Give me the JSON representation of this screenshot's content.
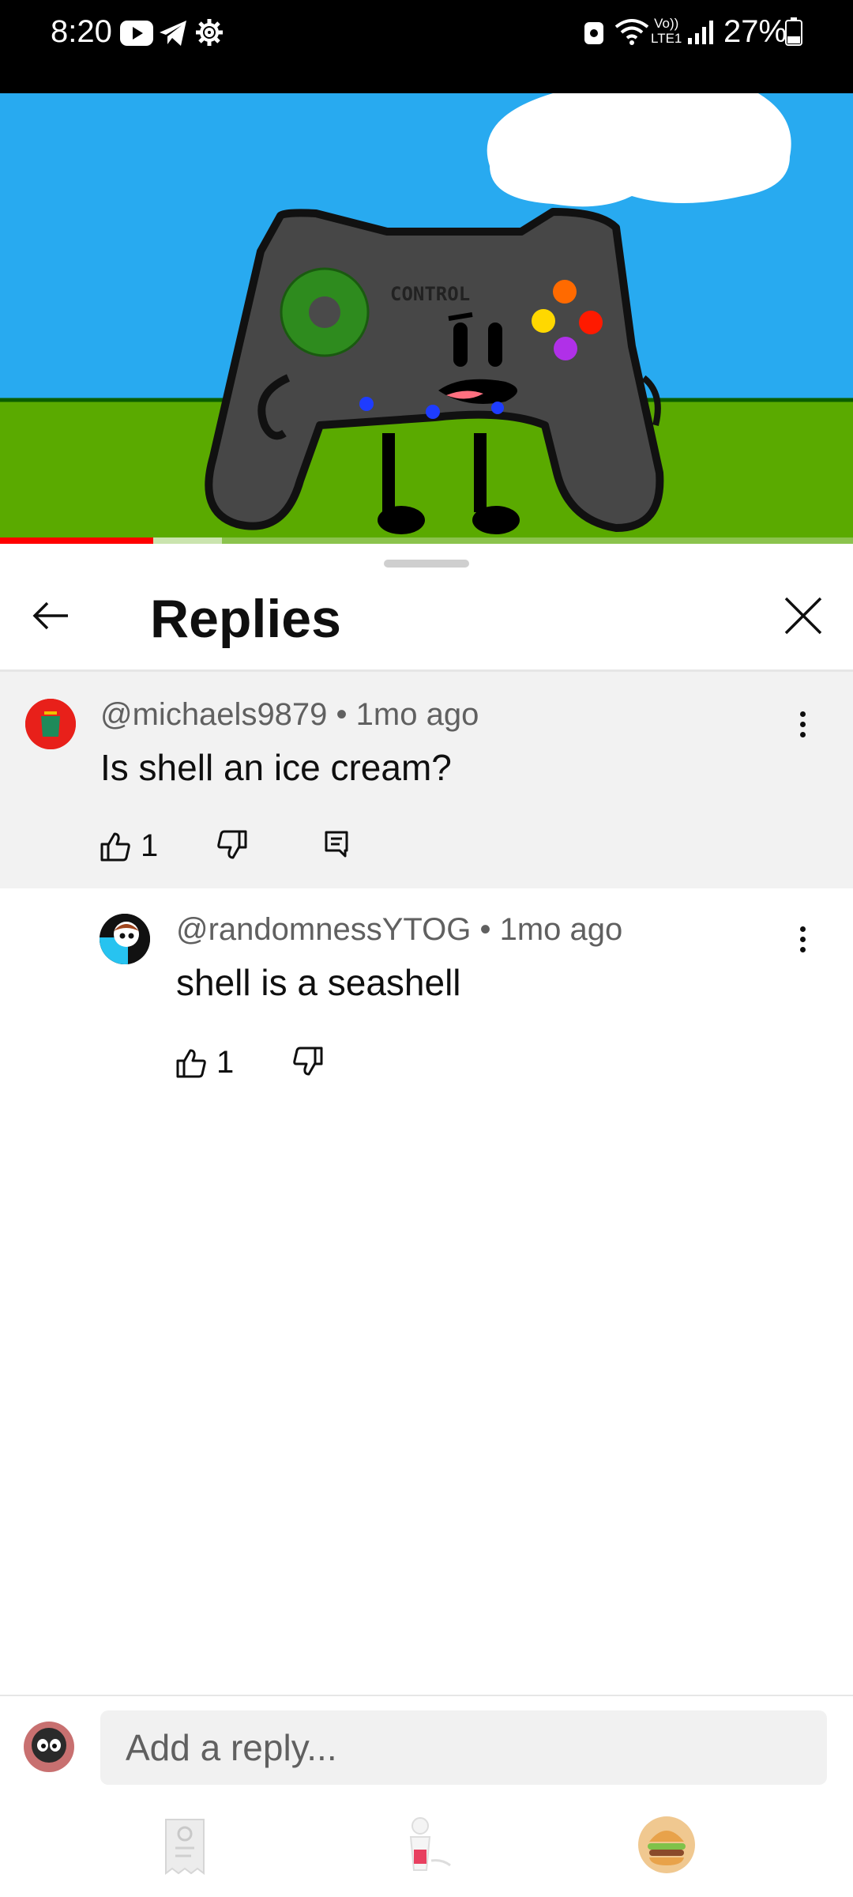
{
  "status_bar": {
    "time": "8:20",
    "left_icons": [
      "youtube-icon",
      "telegram-icon",
      "settings-icon"
    ],
    "right_icons": [
      "vpn-lock-icon",
      "wifi-icon",
      "volte-icon",
      "signal-icon",
      "battery-icon"
    ],
    "volte_line1": "Vo))",
    "volte_line2": "LTE1",
    "battery_percent": "27%"
  },
  "video": {
    "controller_label": "CONTROL",
    "progress_played": 0.18,
    "progress_buffered": 0.26
  },
  "sheet": {
    "title": "Replies"
  },
  "comments": [
    {
      "author": "@michaels9879",
      "age": "1mo ago",
      "meta": "@michaels9879 • 1mo ago",
      "text": "Is shell an ice cream?",
      "likes": "1"
    },
    {
      "author": "@randomnessYTOG",
      "age": "1mo ago",
      "meta": "@randomnessYTOG • 1mo ago",
      "text": "shell is a seashell",
      "likes": "1"
    }
  ],
  "composer": {
    "placeholder": "Add a reply..."
  },
  "stickers": [
    "receipt-sticker",
    "cup-sticker",
    "burger-sticker"
  ],
  "colors": {
    "accent_red": "#ff0000",
    "sky": "#28aaf0",
    "grass": "#5aaa00",
    "highlight_bg": "#f2f2f2"
  }
}
